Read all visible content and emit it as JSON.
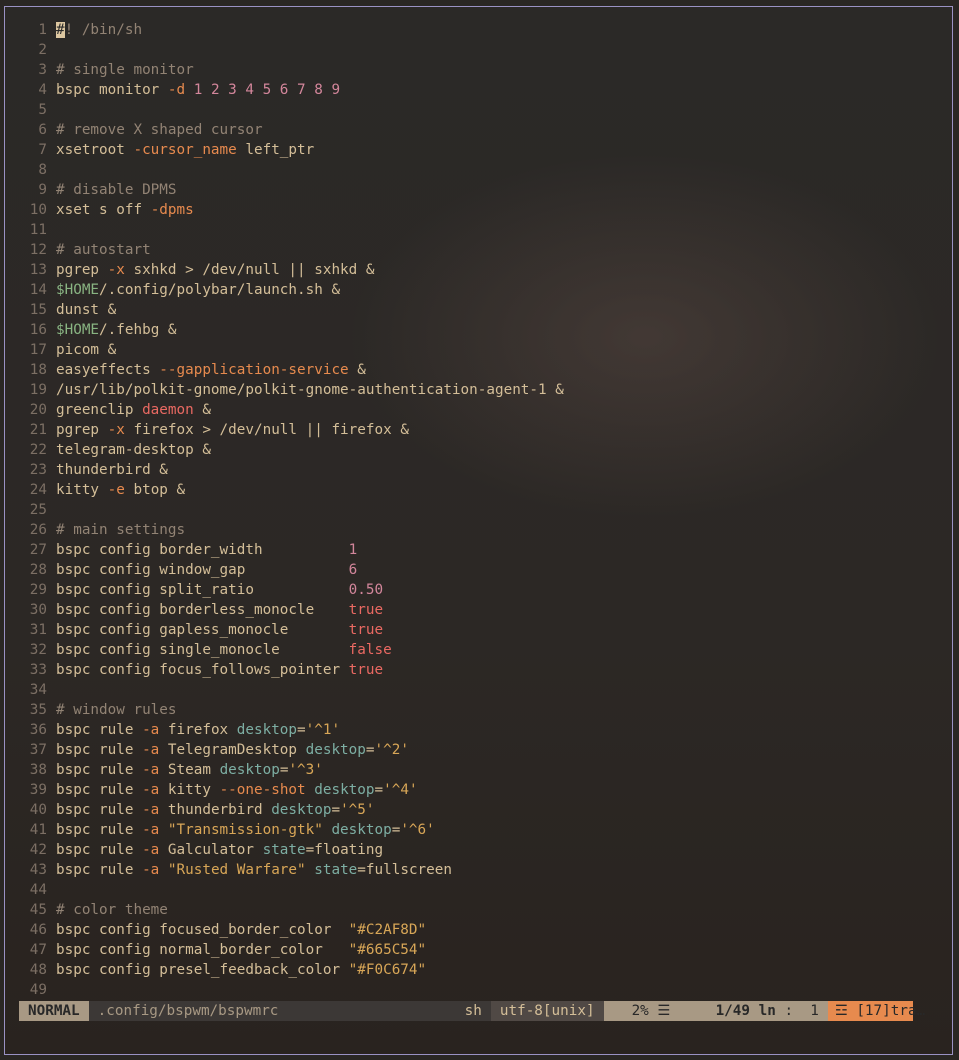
{
  "editor": {
    "lines": [
      {
        "n": "1",
        "t": [
          {
            "c": "cur",
            "s": "#"
          },
          {
            "c": "cm",
            "s": "! /bin/sh"
          }
        ]
      },
      {
        "n": "2",
        "t": []
      },
      {
        "n": "3",
        "t": [
          {
            "c": "cm",
            "s": "# single monitor"
          }
        ]
      },
      {
        "n": "4",
        "t": [
          {
            "c": "",
            "s": "bspc monitor "
          },
          {
            "c": "fl",
            "s": "-d"
          },
          {
            "c": "",
            "s": " "
          },
          {
            "c": "nm",
            "s": "1 2 3 4 5 6 7 8 9"
          }
        ]
      },
      {
        "n": "5",
        "t": []
      },
      {
        "n": "6",
        "t": [
          {
            "c": "cm",
            "s": "# remove X shaped cursor"
          }
        ]
      },
      {
        "n": "7",
        "t": [
          {
            "c": "",
            "s": "xsetroot "
          },
          {
            "c": "fl",
            "s": "-cursor_name"
          },
          {
            "c": "",
            "s": " left_ptr"
          }
        ]
      },
      {
        "n": "8",
        "t": []
      },
      {
        "n": "9",
        "t": [
          {
            "c": "cm",
            "s": "# disable DPMS"
          }
        ]
      },
      {
        "n": "10",
        "t": [
          {
            "c": "",
            "s": "xset s off "
          },
          {
            "c": "fl",
            "s": "-dpms"
          }
        ]
      },
      {
        "n": "11",
        "t": []
      },
      {
        "n": "12",
        "t": [
          {
            "c": "cm",
            "s": "# autostart"
          }
        ]
      },
      {
        "n": "13",
        "t": [
          {
            "c": "",
            "s": "pgrep "
          },
          {
            "c": "fl",
            "s": "-x"
          },
          {
            "c": "",
            "s": " sxhkd > /dev/null || sxhkd &"
          }
        ]
      },
      {
        "n": "14",
        "t": [
          {
            "c": "va",
            "s": "$HOME"
          },
          {
            "c": "",
            "s": "/.config/polybar/launch.sh &"
          }
        ]
      },
      {
        "n": "15",
        "t": [
          {
            "c": "",
            "s": "dunst &"
          }
        ]
      },
      {
        "n": "16",
        "t": [
          {
            "c": "va",
            "s": "$HOME"
          },
          {
            "c": "",
            "s": "/.fehbg &"
          }
        ]
      },
      {
        "n": "17",
        "t": [
          {
            "c": "",
            "s": "picom &"
          }
        ]
      },
      {
        "n": "18",
        "t": [
          {
            "c": "",
            "s": "easyeffects "
          },
          {
            "c": "fl",
            "s": "--gapplication-service"
          },
          {
            "c": "",
            "s": " &"
          }
        ]
      },
      {
        "n": "19",
        "t": [
          {
            "c": "",
            "s": "/usr/lib/polkit-gnome/polkit-gnome-authentication-agent-1 &"
          }
        ]
      },
      {
        "n": "20",
        "t": [
          {
            "c": "",
            "s": "greenclip "
          },
          {
            "c": "bo",
            "s": "daemon"
          },
          {
            "c": "",
            "s": " &"
          }
        ]
      },
      {
        "n": "21",
        "t": [
          {
            "c": "",
            "s": "pgrep "
          },
          {
            "c": "fl",
            "s": "-x"
          },
          {
            "c": "",
            "s": " firefox > /dev/null || firefox &"
          }
        ]
      },
      {
        "n": "22",
        "t": [
          {
            "c": "",
            "s": "telegram-desktop &"
          }
        ]
      },
      {
        "n": "23",
        "t": [
          {
            "c": "",
            "s": "thunderbird &"
          }
        ]
      },
      {
        "n": "24",
        "t": [
          {
            "c": "",
            "s": "kitty "
          },
          {
            "c": "fl",
            "s": "-e"
          },
          {
            "c": "",
            "s": " btop &"
          }
        ]
      },
      {
        "n": "25",
        "t": []
      },
      {
        "n": "26",
        "t": [
          {
            "c": "cm",
            "s": "# main settings"
          }
        ]
      },
      {
        "n": "27",
        "t": [
          {
            "c": "",
            "s": "bspc config border_width          "
          },
          {
            "c": "nm",
            "s": "1"
          }
        ]
      },
      {
        "n": "28",
        "t": [
          {
            "c": "",
            "s": "bspc config window_gap            "
          },
          {
            "c": "nm",
            "s": "6"
          }
        ]
      },
      {
        "n": "29",
        "t": [
          {
            "c": "",
            "s": "bspc config split_ratio           "
          },
          {
            "c": "nm",
            "s": "0.50"
          }
        ]
      },
      {
        "n": "30",
        "t": [
          {
            "c": "",
            "s": "bspc config borderless_monocle    "
          },
          {
            "c": "bo",
            "s": "true"
          }
        ]
      },
      {
        "n": "31",
        "t": [
          {
            "c": "",
            "s": "bspc config gapless_monocle       "
          },
          {
            "c": "bo",
            "s": "true"
          }
        ]
      },
      {
        "n": "32",
        "t": [
          {
            "c": "",
            "s": "bspc config single_monocle        "
          },
          {
            "c": "bo",
            "s": "false"
          }
        ]
      },
      {
        "n": "33",
        "t": [
          {
            "c": "",
            "s": "bspc config focus_follows_pointer "
          },
          {
            "c": "bo",
            "s": "true"
          }
        ]
      },
      {
        "n": "34",
        "t": []
      },
      {
        "n": "35",
        "t": [
          {
            "c": "cm",
            "s": "# window rules"
          }
        ]
      },
      {
        "n": "36",
        "t": [
          {
            "c": "",
            "s": "bspc rule "
          },
          {
            "c": "fl",
            "s": "-a"
          },
          {
            "c": "",
            "s": " firefox "
          },
          {
            "c": "at",
            "s": "desktop"
          },
          {
            "c": "",
            "s": "="
          },
          {
            "c": "st",
            "s": "'^1'"
          }
        ]
      },
      {
        "n": "37",
        "t": [
          {
            "c": "",
            "s": "bspc rule "
          },
          {
            "c": "fl",
            "s": "-a"
          },
          {
            "c": "",
            "s": " TelegramDesktop "
          },
          {
            "c": "at",
            "s": "desktop"
          },
          {
            "c": "",
            "s": "="
          },
          {
            "c": "st",
            "s": "'^2'"
          }
        ]
      },
      {
        "n": "38",
        "t": [
          {
            "c": "",
            "s": "bspc rule "
          },
          {
            "c": "fl",
            "s": "-a"
          },
          {
            "c": "",
            "s": " Steam "
          },
          {
            "c": "at",
            "s": "desktop"
          },
          {
            "c": "",
            "s": "="
          },
          {
            "c": "st",
            "s": "'^3'"
          }
        ]
      },
      {
        "n": "39",
        "t": [
          {
            "c": "",
            "s": "bspc rule "
          },
          {
            "c": "fl",
            "s": "-a"
          },
          {
            "c": "",
            "s": " kitty "
          },
          {
            "c": "fl",
            "s": "--one-shot"
          },
          {
            "c": "",
            "s": " "
          },
          {
            "c": "at",
            "s": "desktop"
          },
          {
            "c": "",
            "s": "="
          },
          {
            "c": "st",
            "s": "'^4'"
          }
        ]
      },
      {
        "n": "40",
        "t": [
          {
            "c": "",
            "s": "bspc rule "
          },
          {
            "c": "fl",
            "s": "-a"
          },
          {
            "c": "",
            "s": " thunderbird "
          },
          {
            "c": "at",
            "s": "desktop"
          },
          {
            "c": "",
            "s": "="
          },
          {
            "c": "st",
            "s": "'^5'"
          }
        ]
      },
      {
        "n": "41",
        "t": [
          {
            "c": "",
            "s": "bspc rule "
          },
          {
            "c": "fl",
            "s": "-a"
          },
          {
            "c": "",
            "s": " "
          },
          {
            "c": "st",
            "s": "\"Transmission-gtk\""
          },
          {
            "c": "",
            "s": " "
          },
          {
            "c": "at",
            "s": "desktop"
          },
          {
            "c": "",
            "s": "="
          },
          {
            "c": "st",
            "s": "'^6'"
          }
        ]
      },
      {
        "n": "42",
        "t": [
          {
            "c": "",
            "s": "bspc rule "
          },
          {
            "c": "fl",
            "s": "-a"
          },
          {
            "c": "",
            "s": " Galculator "
          },
          {
            "c": "at",
            "s": "state"
          },
          {
            "c": "",
            "s": "=floating"
          }
        ]
      },
      {
        "n": "43",
        "t": [
          {
            "c": "",
            "s": "bspc rule "
          },
          {
            "c": "fl",
            "s": "-a"
          },
          {
            "c": "",
            "s": " "
          },
          {
            "c": "st",
            "s": "\"Rusted Warfare\""
          },
          {
            "c": "",
            "s": " "
          },
          {
            "c": "at",
            "s": "state"
          },
          {
            "c": "",
            "s": "=fullscreen"
          }
        ]
      },
      {
        "n": "44",
        "t": []
      },
      {
        "n": "45",
        "t": [
          {
            "c": "cm",
            "s": "# color theme"
          }
        ]
      },
      {
        "n": "46",
        "t": [
          {
            "c": "",
            "s": "bspc config focused_border_color  "
          },
          {
            "c": "st",
            "s": "\"#C2AF8D\""
          }
        ]
      },
      {
        "n": "47",
        "t": [
          {
            "c": "",
            "s": "bspc config normal_border_color   "
          },
          {
            "c": "st",
            "s": "\"#665C54\""
          }
        ]
      },
      {
        "n": "48",
        "t": [
          {
            "c": "",
            "s": "bspc config presel_feedback_color "
          },
          {
            "c": "st",
            "s": "\"#F0C674\""
          }
        ]
      },
      {
        "n": "49",
        "t": []
      }
    ]
  },
  "statusline": {
    "mode": "NORMAL",
    "file": ".config/bspwm/bspwmrc",
    "filetype": "sh",
    "encoding": "utf-8[unix]",
    "percent": "2%",
    "percent_icon": "☰",
    "line_col": "1/49",
    "ln_icon": "ln",
    "col_sep": ":",
    "col": "1",
    "warn_icon": "☲",
    "warn": "[17]tra…"
  },
  "colors": {
    "fg": "#d4be98",
    "comment": "#928374",
    "flag": "#e78a4e",
    "number": "#d3869b",
    "boolean": "#ea6962",
    "variable": "#89b482",
    "string": "#d8a657",
    "attribute": "#7daea3"
  }
}
